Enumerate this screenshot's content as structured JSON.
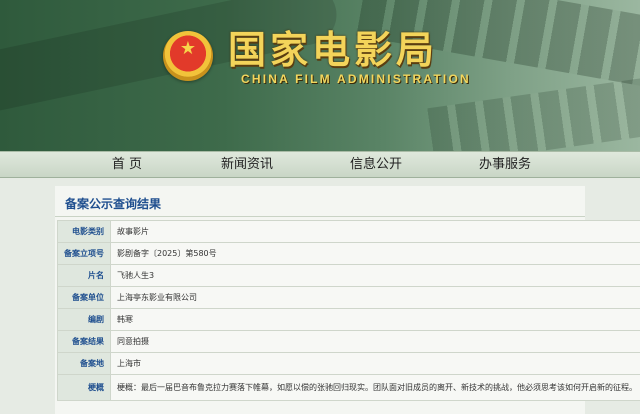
{
  "header": {
    "title": "国家电影局",
    "subtitle": "CHINA FILM ADMINISTRATION",
    "emblem_icon": "national-emblem-icon"
  },
  "nav": {
    "items": [
      {
        "label": "首 页"
      },
      {
        "label": "新闻资讯"
      },
      {
        "label": "信息公开"
      },
      {
        "label": "办事服务"
      }
    ]
  },
  "main": {
    "section_title": "备案公示查询结果",
    "rows": [
      {
        "label": "电影类别",
        "value": "故事影片"
      },
      {
        "label": "备案立项号",
        "value": "影剧备字〔2025〕第580号"
      },
      {
        "label": "片名",
        "value": "飞驰人生3"
      },
      {
        "label": "备案单位",
        "value": "上海亭东影业有限公司"
      },
      {
        "label": "编剧",
        "value": "韩寒"
      },
      {
        "label": "备案结果",
        "value": "同意拍摄"
      },
      {
        "label": "备案地",
        "value": "上海市"
      },
      {
        "label": "梗概",
        "value": "梗概：最后一届巴音布鲁克拉力赛落下帷幕，如愿以偿的张驰回归现实。团队面对旧成员的离开、新技术的挑战，他必须思考该如何开启新的征程。"
      }
    ]
  },
  "colors": {
    "banner_dark": "#2f5a3c",
    "title_gold": "#f3d45a",
    "label_blue": "#1f4f8f",
    "nav_bg": "#d5e0d2"
  }
}
